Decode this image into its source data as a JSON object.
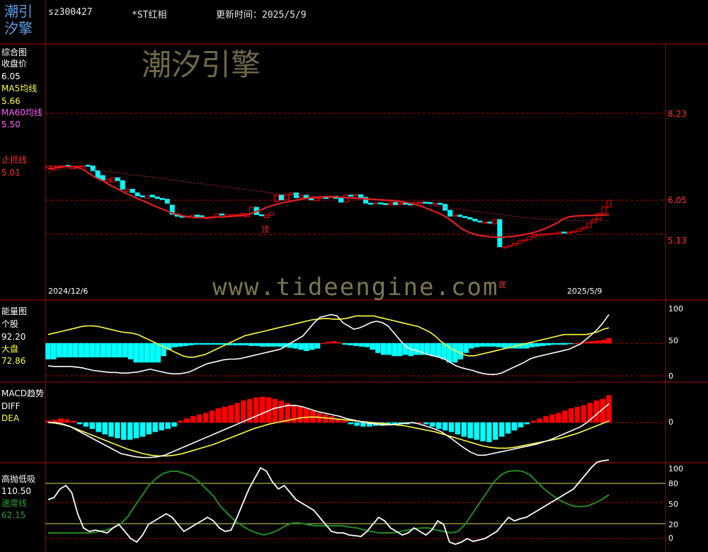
{
  "header": {
    "logo_top": "潮引",
    "logo_bottom": "汐擎",
    "code": "sz300427",
    "name": "*ST红相",
    "update_label": "更新时间：2025/5/9"
  },
  "watermark": {
    "cn": "潮汐引擎",
    "url": "www.tideengine.com"
  },
  "colors": {
    "grid": "#b00000",
    "bull": "#ff0000",
    "bear": "#00ffff",
    "white": "#ffffff",
    "yellow": "#ffff40",
    "green": "#228b22",
    "stop": "#ff2020"
  },
  "panels": {
    "main": {
      "title": "综合图",
      "close_label": "收盘价",
      "close_value": "6.05",
      "ma5_label": "MA5均线",
      "ma5_value": "5.66",
      "ma60_label": "MA60均线",
      "ma60_value": "5.50",
      "stop_label": "止损线",
      "stop_value": "5.01",
      "price_ticks": [
        "8.23",
        "6.05",
        "5.13"
      ],
      "start_date": "2024/12/6",
      "end_date": "2025/5/9",
      "top_marker": "顶",
      "bottom_marker": "底"
    },
    "energy": {
      "title": "能量图",
      "stock_label": "个股",
      "stock_value": "92.20",
      "market_label": "大盘",
      "market_value": "72.86",
      "ticks": [
        "100",
        "50",
        "0"
      ]
    },
    "macd": {
      "title": "MACD趋势",
      "diff_label": "DIFF",
      "dea_label": "DEA",
      "ticks": [
        "0"
      ]
    },
    "hilo": {
      "title": "高抛低吸",
      "value": "110.50",
      "speed_label": "速度线",
      "speed_value": "62.15",
      "ticks": [
        "100",
        "80",
        "50",
        "20",
        "0"
      ]
    }
  },
  "chart_data": [
    {
      "type": "candlestick",
      "panel": "main",
      "x_start": "2024/12/6",
      "x_end": "2025/5/9",
      "n": 100,
      "price_axis": [
        8.23,
        6.05,
        5.13
      ],
      "close": [
        6.98,
        6.98,
        6.98,
        6.98,
        6.95,
        6.96,
        6.98,
        6.98,
        6.98,
        6.85,
        6.65,
        6.6,
        6.62,
        6.66,
        6.58,
        6.35,
        6.35,
        6.26,
        6.17,
        6.14,
        6.17,
        6.14,
        6.1,
        6.08,
        5.97,
        5.67,
        5.62,
        5.59,
        5.62,
        5.65,
        5.59,
        5.58,
        5.58,
        5.6,
        5.68,
        5.65,
        5.66,
        5.66,
        5.66,
        5.69,
        5.69,
        5.86,
        5.66,
        5.63,
        5.65,
        5.72,
        6.19,
        6.06,
        6.21,
        6.25,
        6.12,
        6.19,
        6.09,
        6.08,
        6.1,
        6.13,
        6.12,
        6.16,
        6.1,
        6.0,
        6.19,
        6.17,
        6.2,
        6.13,
        5.97,
        5.95,
        5.98,
        5.96,
        5.93,
        5.99,
        5.93,
        5.97,
        5.95,
        5.93,
        6.0,
        6.0,
        5.99,
        5.96,
        5.97,
        5.94,
        5.78,
        5.62,
        5.65,
        5.61,
        5.58,
        5.54,
        5.49,
        5.46,
        5.46,
        5.45,
        5.53,
        4.79,
        4.79,
        4.83,
        4.89,
        4.95,
        4.98,
        5.06,
        5.12,
        5.13,
        5.14,
        5.15,
        5.16,
        5.19,
        5.17,
        5.19,
        5.21,
        5.27,
        5.32,
        5.44,
        5.54,
        5.7,
        5.87,
        6.05
      ],
      "open": [
        6.92,
        6.88,
        6.92,
        6.95,
        7.0,
        6.9,
        6.93,
        6.97,
        7.0,
        6.98,
        6.85,
        6.72,
        6.55,
        6.55,
        6.66,
        6.58,
        6.29,
        6.35,
        6.25,
        6.17,
        6.1,
        6.19,
        6.14,
        6.1,
        6.08,
        5.92,
        5.68,
        5.62,
        5.59,
        5.6,
        5.65,
        5.63,
        5.56,
        5.58,
        5.6,
        5.68,
        5.62,
        5.66,
        5.66,
        5.66,
        5.6,
        5.69,
        5.86,
        5.66,
        5.58,
        5.65,
        6.02,
        6.19,
        6.06,
        6.21,
        6.25,
        6.12,
        6.19,
        6.09,
        6.04,
        6.1,
        6.13,
        6.12,
        6.16,
        6.1,
        6.0,
        6.19,
        6.17,
        6.2,
        6.13,
        5.97,
        5.95,
        5.98,
        5.96,
        5.93,
        5.99,
        5.93,
        5.97,
        5.95,
        5.93,
        6.0,
        6.0,
        5.99,
        5.96,
        5.97,
        5.94,
        5.78,
        5.62,
        5.65,
        5.61,
        5.58,
        5.54,
        5.49,
        5.46,
        5.46,
        5.41,
        5.53,
        4.79,
        4.79,
        4.83,
        4.89,
        4.95,
        4.98,
        5.06,
        5.12,
        5.13,
        5.14,
        5.15,
        5.16,
        5.19,
        5.17,
        5.19,
        5.21,
        5.27,
        5.32,
        5.44,
        5.54,
        5.7,
        5.87
      ],
      "ma5": [
        6.9,
        6.92,
        6.95,
        6.96,
        6.97,
        6.95,
        6.9,
        6.8,
        6.7,
        6.62,
        6.55,
        6.45,
        6.38,
        6.3,
        6.22,
        6.15,
        6.08,
        6.02,
        5.95,
        5.88,
        5.82,
        5.76,
        5.7,
        5.66,
        5.62,
        5.6,
        5.58,
        5.58,
        5.58,
        5.59,
        5.6,
        5.6,
        5.61,
        5.62,
        5.63,
        5.65,
        5.7,
        5.76,
        5.82,
        5.88,
        5.93,
        5.97,
        6.0,
        6.03,
        6.06,
        6.09,
        6.11,
        6.13,
        6.14,
        6.15,
        6.15,
        6.14,
        6.13,
        6.12,
        6.11,
        6.1,
        6.09,
        6.08,
        6.07,
        6.06,
        6.05,
        6.04,
        6.02,
        6.0,
        5.97,
        5.93,
        5.88,
        5.82,
        5.76,
        5.7,
        5.62,
        5.52,
        5.4,
        5.28,
        5.2,
        5.14,
        5.1,
        5.08,
        5.06,
        5.05,
        5.05,
        5.06,
        5.07,
        5.09,
        5.12,
        5.15,
        5.19,
        5.24,
        5.3,
        5.37,
        5.45,
        5.55,
        5.6,
        5.62,
        5.63,
        5.64,
        5.64,
        5.65,
        5.65,
        5.66
      ],
      "ma60": [
        6.8,
        6.85,
        6.88,
        6.9,
        6.92,
        6.92,
        6.91,
        6.9,
        6.88,
        6.86,
        6.84,
        6.82,
        6.8,
        6.78,
        6.76,
        6.74,
        6.72,
        6.7,
        6.68,
        6.66,
        6.64,
        6.62,
        6.6,
        6.58,
        6.56,
        6.54,
        6.52,
        6.5,
        6.48,
        6.46,
        6.44,
        6.42,
        6.4,
        6.38,
        6.36,
        6.34,
        6.32,
        6.3,
        6.28,
        6.26,
        6.24,
        6.22,
        6.21,
        6.2,
        6.19,
        6.18,
        6.17,
        6.16,
        6.15,
        6.14,
        6.13,
        6.12,
        6.11,
        6.1,
        6.09,
        6.08,
        6.07,
        6.06,
        6.05,
        6.04,
        6.03,
        6.02,
        6.01,
        6.0,
        5.98,
        5.96,
        5.94,
        5.92,
        5.9,
        5.88,
        5.86,
        5.84,
        5.82,
        5.8,
        5.78,
        5.76,
        5.74,
        5.72,
        5.7,
        5.68,
        5.66,
        5.64,
        5.62,
        5.6,
        5.58,
        5.57,
        5.56,
        5.55,
        5.54,
        5.53,
        5.52,
        5.52,
        5.51,
        5.51,
        5.5,
        5.5,
        5.5,
        5.5,
        5.5,
        5.5
      ]
    },
    {
      "type": "bar+line",
      "panel": "energy",
      "ylim": [
        0,
        100
      ],
      "bars": [
        -25,
        -25,
        -22,
        -22,
        -22,
        -22,
        -22,
        -22,
        -22,
        -22,
        -22,
        -22,
        -22,
        -22,
        -22,
        -25,
        -30,
        -30,
        -30,
        -30,
        -30,
        -20,
        -10,
        -6,
        -5,
        -4,
        -3,
        -2,
        -2,
        -2,
        -2,
        -2,
        -2,
        -3,
        -3,
        -3,
        -3,
        -4,
        -4,
        -5,
        -5,
        -5,
        -5,
        -6,
        -7,
        -8,
        -10,
        -12,
        -10,
        -8,
        0,
        2,
        3,
        1,
        -2,
        -3,
        -4,
        -5,
        -6,
        -10,
        -15,
        -18,
        -18,
        -20,
        -20,
        -18,
        -20,
        -18,
        -18,
        -18,
        -20,
        -22,
        -25,
        -30,
        -30,
        -25,
        -15,
        -8,
        -6,
        -5,
        -5,
        -5,
        -6,
        -7,
        -8,
        -8,
        -8,
        -8,
        -6,
        -5,
        -4,
        -3,
        -2,
        -2,
        -2,
        -1,
        0,
        1,
        2,
        3,
        4,
        5,
        8
      ],
      "stock": [
        15,
        14,
        14,
        14,
        14,
        13,
        12,
        10,
        8,
        7,
        6,
        5,
        5,
        4,
        4,
        5,
        6,
        8,
        10,
        8,
        6,
        4,
        3,
        3,
        4,
        6,
        10,
        14,
        18,
        20,
        22,
        24,
        25,
        25,
        26,
        28,
        30,
        32,
        34,
        36,
        38,
        40,
        45,
        50,
        55,
        60,
        70,
        80,
        88,
        90,
        92,
        90,
        80,
        75,
        70,
        72,
        76,
        80,
        82,
        80,
        75,
        65,
        55,
        45,
        40,
        38,
        35,
        32,
        30,
        28,
        25,
        20,
        15,
        12,
        10,
        8,
        5,
        3,
        2,
        2,
        4,
        8,
        12,
        16,
        20,
        25,
        28,
        30,
        32,
        34,
        36,
        38,
        40,
        44,
        48,
        55,
        62,
        70,
        80,
        92
      ],
      "market": [
        62,
        64,
        66,
        68,
        70,
        72,
        74,
        75,
        75,
        74,
        72,
        70,
        68,
        66,
        65,
        64,
        62,
        58,
        54,
        50,
        46,
        42,
        38,
        34,
        30,
        28,
        28,
        30,
        32,
        36,
        40,
        44,
        48,
        52,
        56,
        60,
        62,
        64,
        66,
        68,
        70,
        72,
        74,
        76,
        78,
        80,
        82,
        84,
        85,
        86,
        86,
        85,
        85,
        86,
        88,
        90,
        90,
        90,
        90,
        88,
        86,
        84,
        82,
        80,
        78,
        76,
        74,
        70,
        66,
        60,
        52,
        46,
        40,
        36,
        32,
        30,
        30,
        32,
        34,
        36,
        38,
        40,
        42,
        44,
        46,
        48,
        50,
        52,
        54,
        56,
        58,
        60,
        62,
        62,
        62,
        62,
        62,
        64,
        66,
        70,
        72
      ]
    },
    {
      "type": "bar+line",
      "panel": "macd",
      "bars": [
        0.02,
        0.03,
        0.05,
        0.04,
        0.02,
        -0.02,
        -0.05,
        -0.08,
        -0.12,
        -0.15,
        -0.18,
        -0.2,
        -0.22,
        -0.22,
        -0.2,
        -0.18,
        -0.15,
        -0.12,
        -0.1,
        -0.08,
        -0.05,
        0.02,
        0.05,
        0.08,
        0.1,
        0.12,
        0.15,
        0.18,
        0.2,
        0.22,
        0.25,
        0.28,
        0.3,
        0.32,
        0.33,
        0.32,
        0.3,
        0.28,
        0.25,
        0.22,
        0.2,
        0.18,
        0.15,
        0.12,
        0.1,
        0.08,
        0.05,
        0.02,
        -0.02,
        -0.04,
        -0.05,
        -0.05,
        -0.04,
        -0.04,
        -0.03,
        -0.03,
        -0.02,
        -0.02,
        -0.01,
        0.0,
        -0.02,
        -0.05,
        -0.08,
        -0.1,
        -0.12,
        -0.15,
        -0.18,
        -0.2,
        -0.22,
        -0.24,
        -0.25,
        -0.22,
        -0.18,
        -0.14,
        -0.1,
        -0.06,
        -0.02,
        0.02,
        0.05,
        0.08,
        0.1,
        0.12,
        0.15,
        0.18,
        0.2,
        0.22,
        0.25,
        0.28,
        0.3,
        0.35
      ],
      "diff": [
        0.0,
        0.0,
        -0.02,
        -0.05,
        -0.1,
        -0.15,
        -0.2,
        -0.25,
        -0.3,
        -0.35,
        -0.4,
        -0.42,
        -0.44,
        -0.45,
        -0.45,
        -0.44,
        -0.42,
        -0.38,
        -0.34,
        -0.3,
        -0.26,
        -0.22,
        -0.18,
        -0.14,
        -0.1,
        -0.06,
        -0.02,
        0.02,
        0.06,
        0.1,
        0.14,
        0.18,
        0.2,
        0.22,
        0.22,
        0.2,
        0.17,
        0.14,
        0.12,
        0.1,
        0.08,
        0.05,
        0.03,
        0.01,
        -0.01,
        -0.02,
        -0.03,
        -0.03,
        -0.02,
        -0.01,
        0.0,
        -0.02,
        -0.05,
        -0.08,
        -0.12,
        -0.18,
        -0.25,
        -0.32,
        -0.38,
        -0.42,
        -0.42,
        -0.4,
        -0.38,
        -0.36,
        -0.34,
        -0.32,
        -0.3,
        -0.28,
        -0.25,
        -0.22,
        -0.18,
        -0.14,
        -0.1,
        -0.06,
        0.0,
        0.08,
        0.16,
        0.24
      ],
      "dea": [
        0.0,
        -0.01,
        -0.03,
        -0.06,
        -0.1,
        -0.14,
        -0.18,
        -0.22,
        -0.26,
        -0.3,
        -0.34,
        -0.37,
        -0.4,
        -0.42,
        -0.43,
        -0.43,
        -0.42,
        -0.4,
        -0.37,
        -0.34,
        -0.31,
        -0.28,
        -0.24,
        -0.2,
        -0.16,
        -0.12,
        -0.08,
        -0.05,
        -0.02,
        0.0,
        0.02,
        0.04,
        0.06,
        0.07,
        0.07,
        0.06,
        0.05,
        0.04,
        0.03,
        0.02,
        0.01,
        0.0,
        -0.01,
        -0.02,
        -0.03,
        -0.04,
        -0.06,
        -0.08,
        -0.1,
        -0.12,
        -0.15,
        -0.18,
        -0.21,
        -0.24,
        -0.27,
        -0.3,
        -0.32,
        -0.33,
        -0.33,
        -0.32,
        -0.3,
        -0.28,
        -0.26,
        -0.24,
        -0.22,
        -0.2,
        -0.17,
        -0.14,
        -0.1,
        -0.06,
        -0.02,
        0.02
      ]
    },
    {
      "type": "line",
      "panel": "hilo",
      "ylim": [
        0,
        100
      ],
      "ticks": [
        100,
        80,
        50,
        20,
        0
      ],
      "white": [
        55,
        58,
        70,
        75,
        65,
        35,
        15,
        10,
        12,
        10,
        8,
        15,
        20,
        10,
        0,
        -5,
        5,
        20,
        25,
        30,
        35,
        30,
        20,
        10,
        15,
        20,
        25,
        30,
        25,
        15,
        10,
        12,
        30,
        50,
        70,
        85,
        100,
        95,
        80,
        70,
        75,
        65,
        55,
        50,
        45,
        40,
        30,
        20,
        10,
        8,
        8,
        5,
        4,
        3,
        10,
        20,
        30,
        25,
        15,
        10,
        5,
        8,
        15,
        10,
        5,
        12,
        25,
        20,
        -5,
        -8,
        -5,
        0,
        -4,
        -2,
        0,
        5,
        10,
        20,
        30,
        25,
        28,
        30,
        35,
        40,
        45,
        50,
        55,
        60,
        65,
        70,
        80,
        90,
        100,
        108,
        110,
        111
      ],
      "speed": [
        8,
        8,
        8,
        8,
        8,
        8,
        8,
        10,
        12,
        15,
        20,
        30,
        45,
        60,
        75,
        85,
        92,
        95,
        95,
        92,
        88,
        80,
        70,
        60,
        45,
        35,
        25,
        18,
        12,
        8,
        5,
        8,
        12,
        18,
        22,
        22,
        20,
        18,
        18,
        18,
        18,
        18,
        16,
        15,
        12,
        10,
        8,
        8,
        8,
        10,
        12,
        14,
        15,
        15,
        12,
        10,
        8,
        10,
        20,
        35,
        50,
        65,
        80,
        90,
        95,
        96,
        95,
        90,
        80,
        70,
        62,
        55,
        50,
        46,
        45,
        46,
        50,
        55,
        62
      ]
    }
  ]
}
